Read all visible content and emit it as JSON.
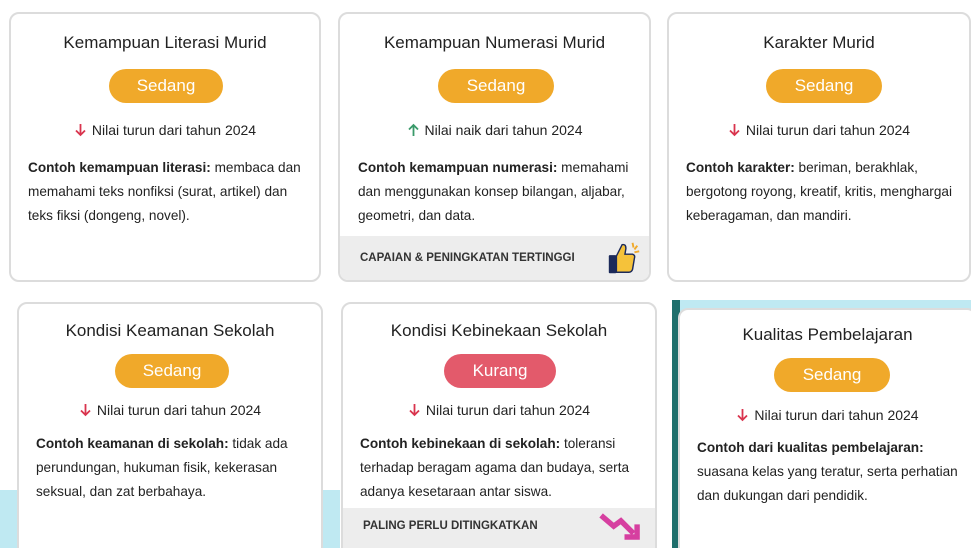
{
  "cards": [
    {
      "title": "Kemampuan Literasi Murid",
      "badge": "Sedang",
      "trend_direction": "down",
      "trend_text": "Nilai turun dari tahun 2024",
      "desc_bold": "Contoh kemampuan literasi:",
      "desc_text": " membaca dan memahami teks nonfiksi (surat, artikel) dan teks fiksi (dongeng, novel)."
    },
    {
      "title": "Kemampuan Numerasi Murid",
      "badge": "Sedang",
      "trend_direction": "up",
      "trend_text": "Nilai naik dari tahun 2024",
      "desc_bold": "Contoh kemampuan numerasi:",
      "desc_text": " memahami dan menggunakan konsep bilangan, aljabar, geometri, dan data.",
      "footer": "CAPAIAN & PENINGKATAN TERTINGGI",
      "footer_icon": "thumbs-up-icon"
    },
    {
      "title": "Karakter Murid",
      "badge": "Sedang",
      "trend_direction": "down",
      "trend_text": "Nilai turun dari tahun 2024",
      "desc_bold": "Contoh karakter:",
      "desc_text": " beriman, berakhlak, bergotong royong, kreatif, kritis, menghargai keberagaman, dan mandiri."
    },
    {
      "title": "Kondisi Keamanan Sekolah",
      "badge": "Sedang",
      "trend_direction": "down",
      "trend_text": "Nilai turun dari tahun 2024",
      "desc_bold": "Contoh keamanan di sekolah:",
      "desc_text": " tidak ada perundungan, hukuman fisik, kekerasan seksual, dan zat berbahaya."
    },
    {
      "title": "Kondisi Kebinekaan Sekolah",
      "badge": "Kurang",
      "trend_direction": "down",
      "trend_text": "Nilai turun dari tahun 2024",
      "desc_bold": "Contoh kebinekaan di sekolah:",
      "desc_text": " toleransi terhadap beragam agama dan budaya, serta adanya kesetaraan antar siswa.",
      "footer": "PALING PERLU DITINGKATKAN",
      "footer_icon": "trend-down-arrow-icon"
    },
    {
      "title": "Kualitas Pembelajaran",
      "badge": "Sedang",
      "trend_direction": "down",
      "trend_text": "Nilai turun dari tahun 2024",
      "desc_bold": "Contoh dari kualitas pembelajaran:",
      "desc_text": " suasana kelas yang teratur, serta perhatian dan dukungan dari pendidik."
    }
  ],
  "colors": {
    "badge_sedang": "#f0a92a",
    "badge_kurang": "#e35a6b",
    "arrow_down": "#d9344e",
    "arrow_up": "#3a9a6a"
  }
}
